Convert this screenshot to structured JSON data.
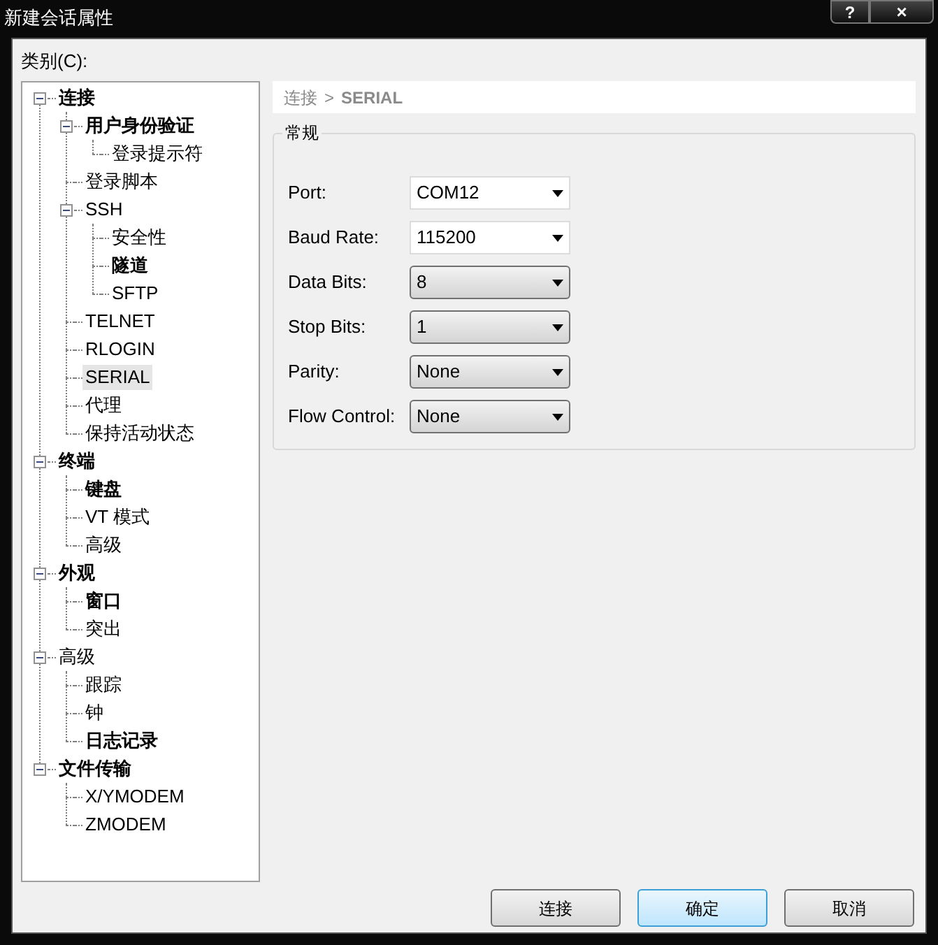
{
  "window": {
    "title": "新建会话属性",
    "help": "?",
    "close": "×"
  },
  "category_label": "类别(C):",
  "tree": [
    {
      "label": "连接",
      "bold": true,
      "expanded": true,
      "selected": false,
      "children": [
        {
          "label": "用户身份验证",
          "bold": true,
          "expanded": true,
          "selected": false,
          "children": [
            {
              "label": "登录提示符",
              "bold": false,
              "selected": false
            }
          ]
        },
        {
          "label": "登录脚本",
          "bold": false,
          "selected": false
        },
        {
          "label": "SSH",
          "bold": false,
          "expanded": true,
          "selected": false,
          "children": [
            {
              "label": "安全性",
              "bold": false,
              "selected": false
            },
            {
              "label": "隧道",
              "bold": true,
              "selected": false
            },
            {
              "label": "SFTP",
              "bold": false,
              "selected": false
            }
          ]
        },
        {
          "label": "TELNET",
          "bold": false,
          "selected": false
        },
        {
          "label": "RLOGIN",
          "bold": false,
          "selected": false
        },
        {
          "label": "SERIAL",
          "bold": false,
          "selected": true
        },
        {
          "label": "代理",
          "bold": false,
          "selected": false
        },
        {
          "label": "保持活动状态",
          "bold": false,
          "selected": false
        }
      ]
    },
    {
      "label": "终端",
      "bold": true,
      "expanded": true,
      "selected": false,
      "children": [
        {
          "label": "键盘",
          "bold": true,
          "selected": false
        },
        {
          "label": "VT 模式",
          "bold": false,
          "selected": false
        },
        {
          "label": "高级",
          "bold": false,
          "selected": false
        }
      ]
    },
    {
      "label": "外观",
      "bold": true,
      "expanded": true,
      "selected": false,
      "children": [
        {
          "label": "窗口",
          "bold": true,
          "selected": false
        },
        {
          "label": "突出",
          "bold": false,
          "selected": false
        }
      ]
    },
    {
      "label": "高级",
      "bold": false,
      "expanded": true,
      "selected": false,
      "children": [
        {
          "label": "跟踪",
          "bold": false,
          "selected": false
        },
        {
          "label": "钟",
          "bold": false,
          "selected": false
        },
        {
          "label": "日志记录",
          "bold": true,
          "selected": false
        }
      ]
    },
    {
      "label": "文件传输",
      "bold": true,
      "expanded": true,
      "selected": false,
      "children": [
        {
          "label": "X/YMODEM",
          "bold": false,
          "selected": false
        },
        {
          "label": "ZMODEM",
          "bold": false,
          "selected": false
        }
      ]
    }
  ],
  "breadcrumb": {
    "parent": "连接",
    "separator": ">",
    "current": "SERIAL"
  },
  "group": {
    "title": "常规",
    "fields": [
      {
        "label": "Port:",
        "value": "COM12",
        "kind": "editable"
      },
      {
        "label": "Baud Rate:",
        "value": "115200",
        "kind": "editable"
      },
      {
        "label": "Data Bits:",
        "value": "8",
        "kind": "dropdown"
      },
      {
        "label": "Stop Bits:",
        "value": "1",
        "kind": "dropdown"
      },
      {
        "label": "Parity:",
        "value": "None",
        "kind": "dropdown"
      },
      {
        "label": "Flow Control:",
        "value": "None",
        "kind": "dropdown"
      }
    ]
  },
  "buttons": [
    {
      "label": "连接",
      "default": false
    },
    {
      "label": "确定",
      "default": true
    },
    {
      "label": "取消",
      "default": false
    }
  ]
}
